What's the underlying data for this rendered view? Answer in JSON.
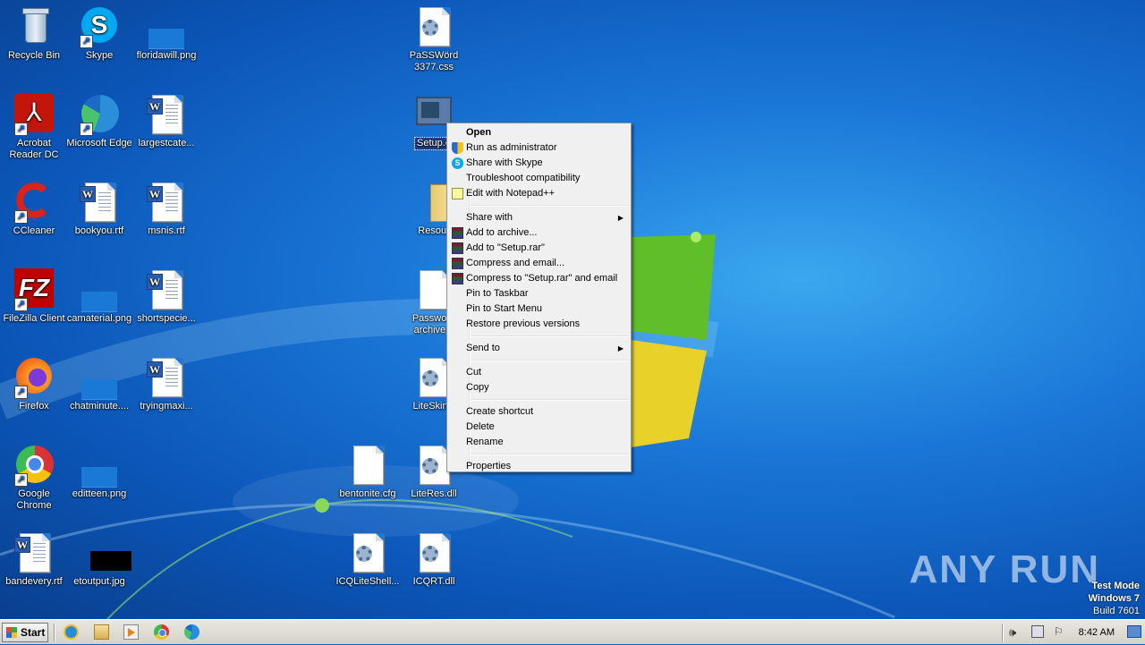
{
  "desktop": {
    "icons": [
      {
        "label": "Recycle Bin"
      },
      {
        "label": "Skype"
      },
      {
        "label": "floridawill.png"
      },
      {
        "label": "PaSSWörd\n3377.css"
      },
      {
        "label": "Acrobat\nReader DC"
      },
      {
        "label": "Microsoft Edge"
      },
      {
        "label": "largestcate..."
      },
      {
        "label": "Setup.e"
      },
      {
        "label": "CCleaner"
      },
      {
        "label": "bookyou.rtf"
      },
      {
        "label": "msnis.rtf"
      },
      {
        "label": "Resour"
      },
      {
        "label": "FileZilla Client"
      },
      {
        "label": "camaterial.png"
      },
      {
        "label": "shortspecie..."
      },
      {
        "label": "Password\narchive 2"
      },
      {
        "label": "Firefox"
      },
      {
        "label": "chatminute...."
      },
      {
        "label": "tryingmaxi..."
      },
      {
        "label": "LiteSkinU"
      },
      {
        "label": "Google\nChrome"
      },
      {
        "label": "editteen.png"
      },
      {
        "label": "bentonite.cfg"
      },
      {
        "label": "LiteRes.dll"
      },
      {
        "label": "bandevery.rtf"
      },
      {
        "label": "etoutput.jpg"
      },
      {
        "label": "ICQLiteShell..."
      },
      {
        "label": "ICQRT.dll"
      }
    ]
  },
  "context_menu": {
    "items": [
      {
        "label": "Open"
      },
      {
        "label": "Run as administrator"
      },
      {
        "label": "Share with Skype"
      },
      {
        "label": "Troubleshoot compatibility"
      },
      {
        "label": "Edit with Notepad++"
      },
      {
        "label": "Share with"
      },
      {
        "label": "Add to archive..."
      },
      {
        "label": "Add to \"Setup.rar\""
      },
      {
        "label": "Compress and email..."
      },
      {
        "label": "Compress to \"Setup.rar\" and email"
      },
      {
        "label": "Pin to Taskbar"
      },
      {
        "label": "Pin to Start Menu"
      },
      {
        "label": "Restore previous versions"
      },
      {
        "label": "Send to"
      },
      {
        "label": "Cut"
      },
      {
        "label": "Copy"
      },
      {
        "label": "Create shortcut"
      },
      {
        "label": "Delete"
      },
      {
        "label": "Rename"
      },
      {
        "label": "Properties"
      }
    ]
  },
  "taskbar": {
    "start_label": "Start",
    "clock": "8:42 AM"
  },
  "watermark": {
    "text": "ANY RUN"
  },
  "system_info": {
    "line1": "Test Mode",
    "line2": "Windows 7",
    "line3": "Build 7601"
  },
  "colors": {
    "desktop_bg": "#1b78d8",
    "menu_bg": "#f0f0f0",
    "selection": "#1f3c8f"
  }
}
